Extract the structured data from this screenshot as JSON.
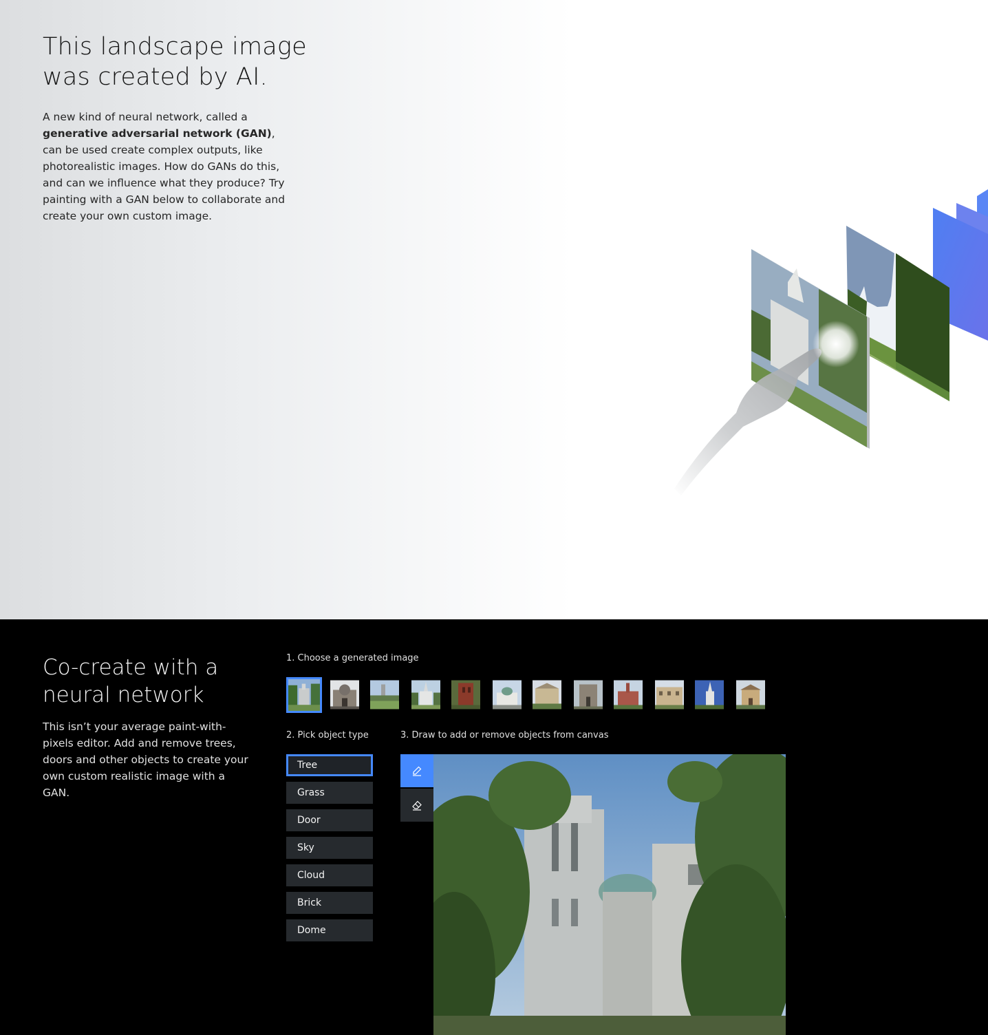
{
  "hero": {
    "title_line1": "This landscape image",
    "title_line2": "was created by AI.",
    "desc_intro": "A new kind of neural network, called a ",
    "desc_bold": "generative adversarial network (GAN)",
    "desc_rest": ", can be used create complex outputs, like photorealistic images. How do GANs do this, and can we influence what they produce? Try painting with a GAN below to collaborate and create your own custom image."
  },
  "cocreate": {
    "title_line1": "Co-create with a",
    "title_line2": "neural network",
    "description": "This isn’t your average paint-with-pixels editor. Add and remove trees, doors and other objects to create your own custom realistic image with a GAN.",
    "step1_label": "1. Choose a generated image",
    "step2_label": "2. Pick object type",
    "step3_label": "3. Draw to add or remove objects from canvas",
    "selected_image_index": 0,
    "object_types": [
      "Tree",
      "Grass",
      "Door",
      "Sky",
      "Cloud",
      "Brick",
      "Dome"
    ],
    "selected_object": "Tree",
    "active_tool": "brush-icon",
    "tools": [
      "brush-icon",
      "eraser-icon"
    ]
  },
  "colors": {
    "accent": "#4589ff",
    "button_bg": "#262a2e",
    "dark_bg": "#000000"
  }
}
